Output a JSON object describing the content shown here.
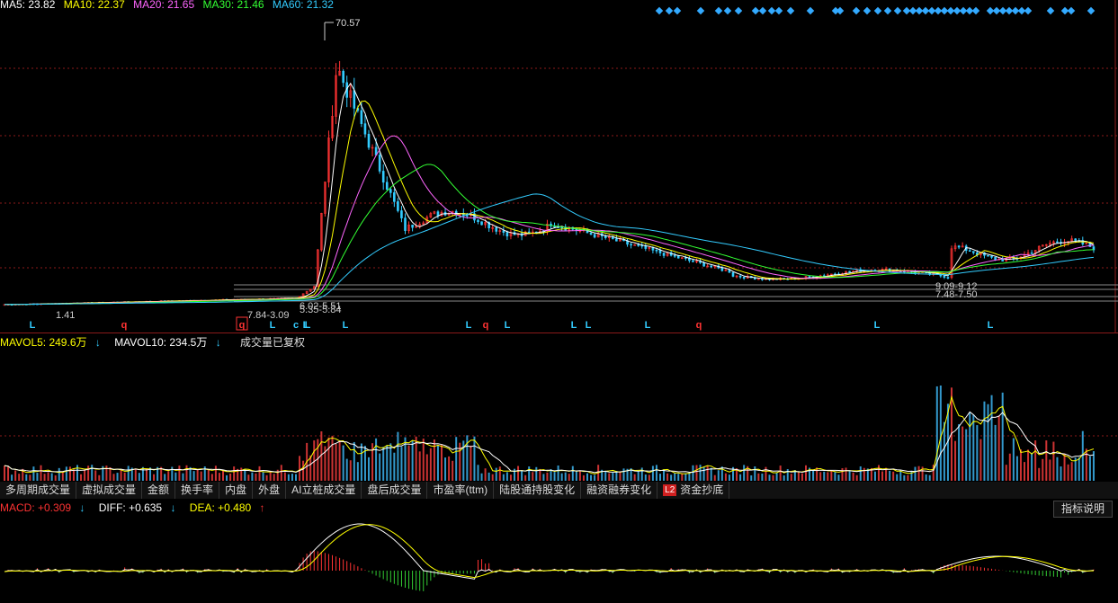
{
  "main": {
    "ma_legend": [
      {
        "label": "MA5: 23.82",
        "color": "#ffffff"
      },
      {
        "label": "MA10: 22.37",
        "color": "#ffff00"
      },
      {
        "label": "MA20: 21.65",
        "color": "#ff66ff"
      },
      {
        "label": "MA30: 21.46",
        "color": "#33ff33"
      },
      {
        "label": "MA60: 21.32",
        "color": "#33ccff"
      }
    ],
    "peak_label": "70.57",
    "low_labels": [
      "1.41",
      "7.84-3.09",
      "6.02-5.51",
      "5.35-5.84",
      "9.09-9.12",
      "7.48-7.50"
    ],
    "signal_markers": [
      "L",
      "q",
      "q",
      "L",
      "c",
      "L",
      "L",
      "L",
      "q",
      "L",
      "L",
      "L",
      "L",
      "q",
      "L",
      "L",
      "L"
    ]
  },
  "volume": {
    "legend": [
      {
        "label": "MAVOL5: 249.6万",
        "color": "#ffff00",
        "arrow": "↓"
      },
      {
        "label": "MAVOL10: 234.5万",
        "color": "#ffffff",
        "arrow": "↓"
      }
    ],
    "note": "成交量已复权"
  },
  "tabs": [
    "多周期成交量",
    "虚拟成交量",
    "金额",
    "换手率",
    "内盘",
    "外盘",
    "AI立桩成交量",
    "盘后成交量",
    "市盈率(ttm)",
    "陆股通持股变化",
    "融资融券变化",
    "资金抄底"
  ],
  "l2_badge": "L2",
  "explain_button": "指标说明",
  "macd": {
    "legend": [
      {
        "label": "MACD: +0.309",
        "color": "#ff3333",
        "arrow": "↓"
      },
      {
        "label": "DIFF: +0.635",
        "color": "#ffffff",
        "arrow": "↓"
      },
      {
        "label": "DEA: +0.480",
        "color": "#ffff00",
        "arrow": "↑"
      }
    ]
  },
  "colors": {
    "up": "#ff3333",
    "down": "#33ccff",
    "grid": "#8b1a1a",
    "diamond": "#33aaff"
  }
}
